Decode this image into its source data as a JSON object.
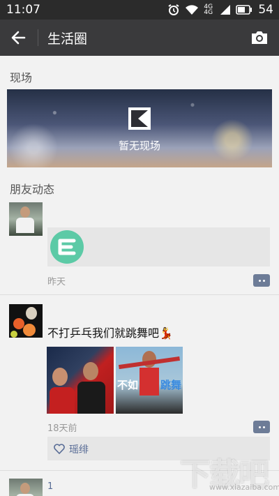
{
  "status_bar": {
    "time": "11:07",
    "battery": "54",
    "network_label_top": "4G",
    "network_label_bottom": "4G"
  },
  "app_bar": {
    "title": "生活圈",
    "back_icon": "arrow-left-icon",
    "camera_icon": "camera-icon"
  },
  "live_section": {
    "label": "现场",
    "empty_text": "暂无现场"
  },
  "feed_section": {
    "label": "朋友动态"
  },
  "posts": [
    {
      "time": "昨天"
    },
    {
      "text": "不打乒乓我们就跳舞吧💃",
      "time": "18天前",
      "like_name": "瑶绯",
      "photo2_text_left": "不如",
      "photo2_text_right": "跳舞"
    },
    {
      "text": "1"
    }
  ],
  "watermark": {
    "main": "下载吧",
    "sub": "www.xiazaiba.com"
  },
  "colors": {
    "status_bar": "#2b2b2b",
    "app_bar": "#3a3a3c",
    "link_blue": "#576b95",
    "page_bg": "#f2f2f2"
  }
}
